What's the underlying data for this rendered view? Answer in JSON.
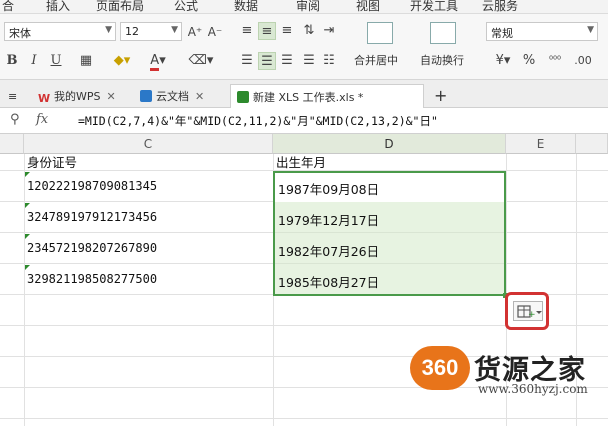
{
  "menu": {
    "items": [
      "合",
      "插入",
      "页面布局",
      "公式",
      "数据",
      "审阅",
      "视图",
      "开发工具",
      "云服务"
    ]
  },
  "ribbon": {
    "font_name": "宋体",
    "font_size": "12",
    "grow_font": "A⁺",
    "shrink_font": "A⁻",
    "bold": "B",
    "italic": "I",
    "underline": "U",
    "font_color_glyph": "A",
    "merge_label": "合并居中",
    "wrap_label": "自动换行",
    "number_format": "常规",
    "percent": "%",
    "accent_color": "#4a9a4a"
  },
  "tabs": {
    "items": [
      {
        "label": "我的WPS",
        "icon": "wps-logo-icon",
        "icon_color": "#d23232"
      },
      {
        "label": "云文档",
        "icon": "cloud-doc-icon",
        "icon_color": "#2b78c8"
      },
      {
        "label": "新建 XLS 工作表.xls *",
        "icon": "spreadsheet-icon",
        "icon_color": "#2d8a2d"
      }
    ],
    "close_glyph": "✕",
    "add_glyph": "+"
  },
  "formula_bar": {
    "fx": "fx",
    "formula": "=MID(C2,7,4)&\"年\"&MID(C2,11,2)&\"月\"&MID(C2,13,2)&\"日\""
  },
  "columns": [
    "C",
    "D",
    "E"
  ],
  "rows": [
    {
      "c": "身份证号",
      "d": "出生年月"
    },
    {
      "c": "120222198709081345",
      "d": "1987年09月08日"
    },
    {
      "c": "324789197912173456",
      "d": "1979年12月17日"
    },
    {
      "c": "234572198207267890",
      "d": "1982年07月26日"
    },
    {
      "c": "329821198508277500",
      "d": "1985年08月27日"
    }
  ],
  "watermark": {
    "badge": "360",
    "brand": "货源之家",
    "url": "www.360hyzj.com"
  }
}
